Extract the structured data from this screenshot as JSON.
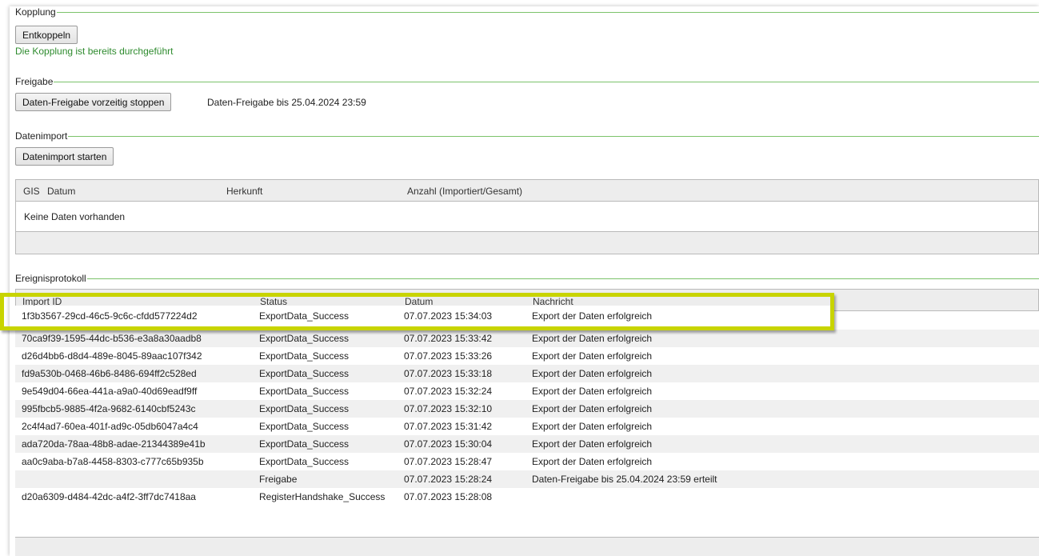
{
  "kopplung": {
    "title": "Kopplung",
    "button": "Entkoppeln",
    "status": "Die Kopplung ist bereits durchgeführt"
  },
  "freigabe": {
    "title": "Freigabe",
    "button": "Daten-Freigabe vorzeitig stoppen",
    "info": "Daten-Freigabe bis 25.04.2024 23:59"
  },
  "datenimport": {
    "title": "Datenimport",
    "button": "Datenimport starten",
    "columns": [
      "GIS",
      "Datum",
      "Herkunft",
      "Anzahl (Importiert/Gesamt)"
    ],
    "empty_text": "Keine Daten vorhanden"
  },
  "ereignisprotokoll": {
    "title": "Ereignisprotokoll",
    "columns": [
      "Import ID",
      "Status",
      "Datum",
      "Nachricht"
    ],
    "highlighted_row": {
      "id": "1f3b3567-29cd-46c5-9c6c-cfdd577224d2",
      "status": "ExportData_Success",
      "date": "07.07.2023 15:34:03",
      "message": "Export der Daten erfolgreich"
    },
    "rows": [
      {
        "id": "",
        "status": "",
        "date": "",
        "message": ""
      },
      {
        "id": "70ca9f39-1595-44dc-b536-e3a8a30aadb8",
        "status": "ExportData_Success",
        "date": "07.07.2023 15:33:42",
        "message": "Export der Daten erfolgreich"
      },
      {
        "id": "d26d4bb6-d8d4-489e-8045-89aac107f342",
        "status": "ExportData_Success",
        "date": "07.07.2023 15:33:26",
        "message": "Export der Daten erfolgreich"
      },
      {
        "id": "fd9a530b-0468-46b6-8486-694ff2c528ed",
        "status": "ExportData_Success",
        "date": "07.07.2023 15:33:18",
        "message": "Export der Daten erfolgreich"
      },
      {
        "id": "9e549d04-66ea-441a-a9a0-40d69eadf9ff",
        "status": "ExportData_Success",
        "date": "07.07.2023 15:32:24",
        "message": "Export der Daten erfolgreich"
      },
      {
        "id": "995fbcb5-9885-4f2a-9682-6140cbf5243c",
        "status": "ExportData_Success",
        "date": "07.07.2023 15:32:10",
        "message": "Export der Daten erfolgreich"
      },
      {
        "id": "2c4f4ad7-60ea-401f-ad9c-05db6047a4c4",
        "status": "ExportData_Success",
        "date": "07.07.2023 15:31:42",
        "message": "Export der Daten erfolgreich"
      },
      {
        "id": "ada720da-78aa-48b8-adae-21344389e41b",
        "status": "ExportData_Success",
        "date": "07.07.2023 15:30:04",
        "message": "Export der Daten erfolgreich"
      },
      {
        "id": "aa0c9aba-b7a8-4458-8303-c777c65b935b",
        "status": "ExportData_Success",
        "date": "07.07.2023 15:28:47",
        "message": "Export der Daten erfolgreich"
      },
      {
        "id": "",
        "status": "Freigabe",
        "date": "07.07.2023 15:28:24",
        "message": "Daten-Freigabe bis 25.04.2024 23:59 erteilt"
      },
      {
        "id": "d20a6309-d484-42dc-a4f2-3ff7dc7418aa",
        "status": "RegisterHandshake_Success",
        "date": "07.07.2023 15:28:08",
        "message": ""
      }
    ]
  },
  "colors": {
    "section_rule": "#7cc36b",
    "success_text": "#2e8b2e",
    "highlight": "#c8d400"
  }
}
